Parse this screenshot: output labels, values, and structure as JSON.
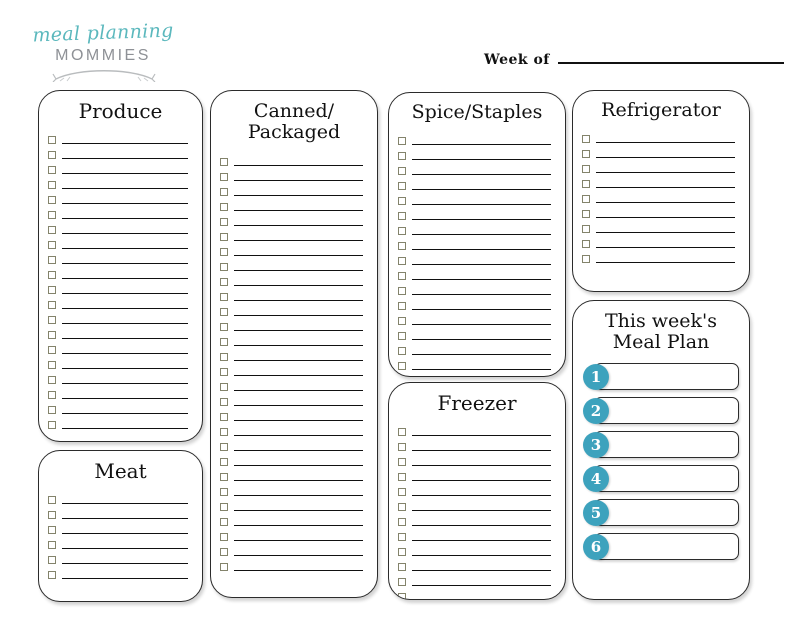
{
  "page": {
    "background_color": "#ffffff",
    "accent_color": "#3da2bd",
    "checkbox_border_color": "#83836b"
  },
  "header": {
    "logo": {
      "script_text": "meal planning",
      "wordmark_text": "MOMMIES",
      "script_color": "#5bb8bd",
      "wordmark_color": "#8e9196"
    },
    "week_of_label": "Week of"
  },
  "cards": [
    {
      "id": "produce",
      "title": "Produce",
      "rows": 20
    },
    {
      "id": "meat",
      "title": "Meat",
      "rows": 6
    },
    {
      "id": "canned",
      "title": "Canned/\nPackaged",
      "rows": 28
    },
    {
      "id": "spice",
      "title": "Spice/Staples",
      "rows": 16
    },
    {
      "id": "freezer",
      "title": "Freezer",
      "rows": 12
    },
    {
      "id": "refrigerator",
      "title": "Refrigerator",
      "rows": 9
    }
  ],
  "meal_plan": {
    "title": "This week's\nMeal Plan",
    "slots": [
      "1",
      "2",
      "3",
      "4",
      "5",
      "6"
    ]
  }
}
